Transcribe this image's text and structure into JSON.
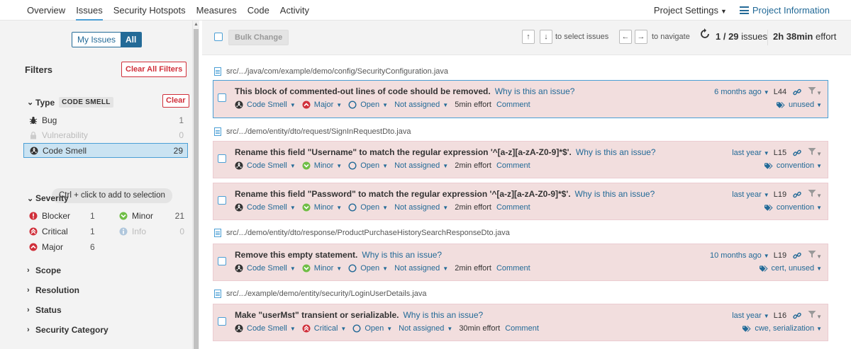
{
  "nav": {
    "tabs": [
      "Overview",
      "Issues",
      "Security Hotspots",
      "Measures",
      "Code",
      "Activity"
    ],
    "active_tab": "Issues",
    "settings": "Project Settings",
    "project_info": "Project Information"
  },
  "sidebar": {
    "toggle": {
      "my": "My Issues",
      "all": "All"
    },
    "filters_title": "Filters",
    "clear_all": "Clear All Filters",
    "type": {
      "title": "Type",
      "badge": "CODE SMELL",
      "clear": "Clear",
      "items": [
        {
          "label": "Bug",
          "count": "1"
        },
        {
          "label": "Vulnerability",
          "count": "0"
        },
        {
          "label": "Code Smell",
          "count": "29"
        }
      ]
    },
    "hint": "Ctrl + click to add to selection",
    "severity": {
      "title": "Severity",
      "items": [
        {
          "label": "Blocker",
          "count": "1"
        },
        {
          "label": "Minor",
          "count": "21"
        },
        {
          "label": "Critical",
          "count": "1"
        },
        {
          "label": "Info",
          "count": "0"
        },
        {
          "label": "Major",
          "count": "6"
        }
      ]
    },
    "collapsed": [
      "Scope",
      "Resolution",
      "Status",
      "Security Category"
    ]
  },
  "toolbar": {
    "bulk_change": "Bulk Change",
    "up": "↑",
    "down": "↓",
    "select_text": "to select issues",
    "left": "←",
    "right": "→",
    "navigate_text": "to navigate",
    "counter_value": "1 / 29",
    "counter_label": "issues",
    "effort_value": "2h 38min",
    "effort_label": "effort"
  },
  "files": [
    "src/.../java/com/example/demo/config/SecurityConfiguration.java",
    "src/.../demo/entity/dto/request/SignInRequestDto.java",
    "src/.../demo/entity/dto/response/ProductPurchaseHistorySearchResponseDto.java",
    "src/.../example/demo/entity/security/LoginUserDetails.java"
  ],
  "issues": [
    {
      "message": "This block of commented-out lines of code should be removed.",
      "why": "Why is this an issue?",
      "type": "Code Smell",
      "severity": "Major",
      "status": "Open",
      "assignee": "Not assigned",
      "effort": "5min effort",
      "comment": "Comment",
      "date": "6 months ago",
      "line": "L44",
      "tags": "unused"
    },
    {
      "message": "Rename this field \"Username\" to match the regular expression '^[a-z][a-zA-Z0-9]*$'.",
      "why": "Why is this an issue?",
      "type": "Code Smell",
      "severity": "Minor",
      "status": "Open",
      "assignee": "Not assigned",
      "effort": "2min effort",
      "comment": "Comment",
      "date": "last year",
      "line": "L15",
      "tags": "convention"
    },
    {
      "message": "Rename this field \"Password\" to match the regular expression '^[a-z][a-zA-Z0-9]*$'.",
      "why": "Why is this an issue?",
      "type": "Code Smell",
      "severity": "Minor",
      "status": "Open",
      "assignee": "Not assigned",
      "effort": "2min effort",
      "comment": "Comment",
      "date": "last year",
      "line": "L19",
      "tags": "convention"
    },
    {
      "message": "Remove this empty statement.",
      "why": "Why is this an issue?",
      "type": "Code Smell",
      "severity": "Minor",
      "status": "Open",
      "assignee": "Not assigned",
      "effort": "2min effort",
      "comment": "Comment",
      "date": "10 months ago",
      "line": "L19",
      "tags": "cert, unused"
    },
    {
      "message": "Make \"userMst\" transient or serializable.",
      "why": "Why is this an issue?",
      "type": "Code Smell",
      "severity": "Critical",
      "status": "Open",
      "assignee": "Not assigned",
      "effort": "30min effort",
      "comment": "Comment",
      "date": "last year",
      "line": "L16",
      "tags": "cwe, serialization"
    }
  ],
  "colors": {
    "link": "#236a97",
    "issue_bg": "#f2dede",
    "selected": "#cae3f2",
    "danger": "#d02f3a"
  }
}
